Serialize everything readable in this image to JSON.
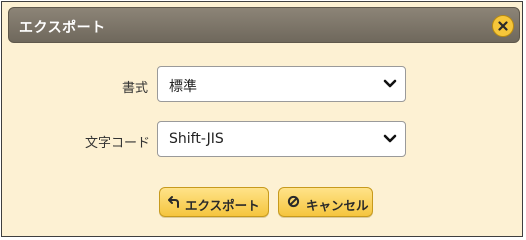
{
  "dialog": {
    "title": "エクスポート",
    "close_icon": "close-x-icon"
  },
  "form": {
    "format": {
      "label": "書式",
      "selected": "標準"
    },
    "charset": {
      "label": "文字コード",
      "selected": "Shift-JIS"
    }
  },
  "buttons": {
    "export": {
      "label": "エクスポート",
      "icon": "undo-arrow-icon"
    },
    "cancel": {
      "label": "キャンセル",
      "icon": "prohibited-icon"
    }
  },
  "colors": {
    "dialog_background": "#fdf1d3",
    "titlebar": "#7d766a",
    "accent_yellow": "#f6c63a"
  }
}
